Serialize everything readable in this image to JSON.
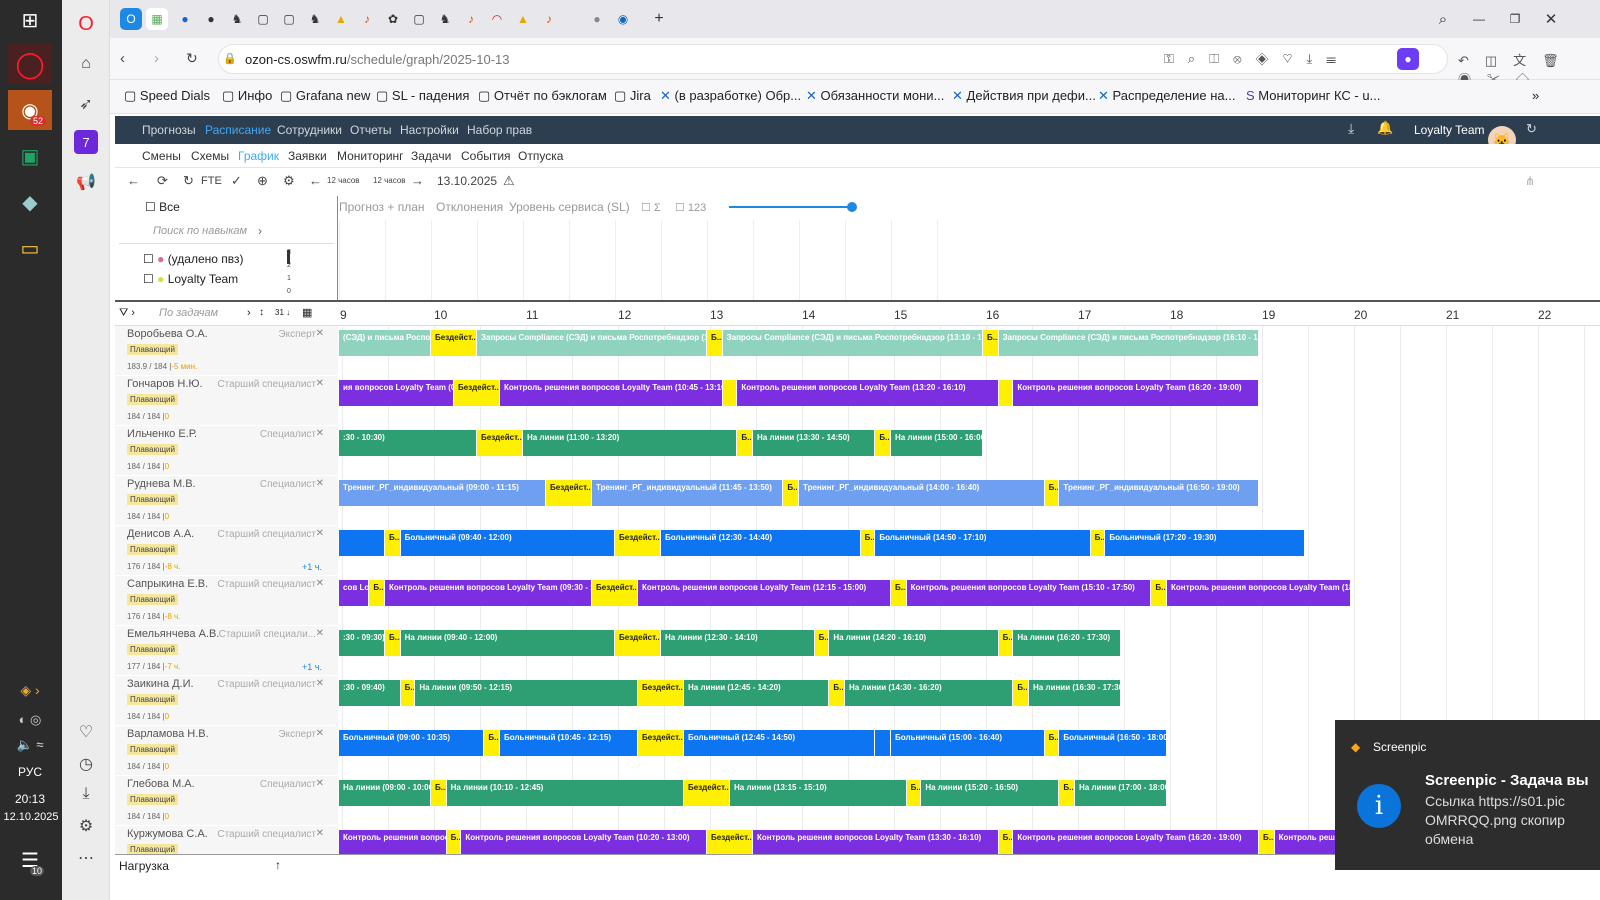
{
  "system": {
    "language": "РУС",
    "time": "20:13",
    "date": "12.10.2025",
    "notif_count": "10",
    "badge": "52"
  },
  "browser": {
    "url_host": "ozon-cs.oswfm.ru",
    "url_path": "/schedule/graph/2025-10-13",
    "bookmarks": [
      "Speed Dials",
      "Инфо",
      "Grafana new",
      "SL - падения",
      "Отчёт по бэклогам",
      "Jira",
      "(в разработке) Обр...",
      "Обязанности мони...",
      "Действия при дефи...",
      "Распределение на...",
      "Мониторинг КС - u..."
    ]
  },
  "app": {
    "nav_main": [
      "Прогнозы",
      "Расписание",
      "Сотрудники",
      "Отчеты",
      "Настройки",
      "Набор прав"
    ],
    "nav_main_active": "Расписание",
    "team": "Loyalty Team",
    "nav_sub": [
      "Смены",
      "Схемы",
      "График",
      "Заявки",
      "Мониторинг",
      "Задачи",
      "События",
      "Отпуска"
    ],
    "nav_sub_active": "График",
    "toolbar": {
      "fte": "FTE",
      "hours_a": "12 часов",
      "hours_b": "12 часов",
      "date": "13.10.2025"
    },
    "filters": {
      "all": "Все",
      "skill_search": "Поиск по навыкам",
      "task_search": "По задачам",
      "groups": [
        "(удалено пвз)",
        "Loyalty Team"
      ]
    },
    "chart_tabs": [
      "Прогноз + план",
      "Отклонения",
      "Уровень сервиса (SL)"
    ],
    "chart_checks": [
      "Σ",
      "123"
    ],
    "mini_axis": [
      "3",
      "2",
      "1",
      "0"
    ],
    "hours": [
      "9",
      "10",
      "11",
      "12",
      "13",
      "14",
      "15",
      "16",
      "17",
      "18",
      "19",
      "20",
      "21",
      "22"
    ],
    "footer": "Нагрузка"
  },
  "employees": [
    {
      "name": "Воробьева О.А.",
      "role": "Эксперт",
      "tag": "Плавающий",
      "hours": "183.9 / 184 |",
      "hours_extra": "-5 мин.",
      "ext": "",
      "segments": [
        {
          "s": 9.0,
          "e": 10.0,
          "c": "teal",
          "t": "(СЭД) и письма Роспот..."
        },
        {
          "s": 10.0,
          "e": 10.5,
          "c": "yellow",
          "t": "Бездейст..."
        },
        {
          "s": 10.5,
          "e": 13.0,
          "c": "teal",
          "t": "Запросы Compliance (СЭД) и письма Роспотребнадзор (10:30 -..."
        },
        {
          "s": 13.0,
          "e": 13.17,
          "c": "yellow",
          "t": "Б..."
        },
        {
          "s": 13.17,
          "e": 16.0,
          "c": "teal",
          "t": "Запросы Compliance (СЭД) и письма Роспотребнадзор (13:10 - 16:00)"
        },
        {
          "s": 16.0,
          "e": 16.17,
          "c": "yellow",
          "t": "Б..."
        },
        {
          "s": 16.17,
          "e": 19.0,
          "c": "teal",
          "t": "Запросы Compliance (СЭД) и письма Роспотребнадзор (16:10 - 19:00)"
        }
      ]
    },
    {
      "name": "Гончаров Н.Ю.",
      "role": "Старший специалист",
      "tag": "Плавающий",
      "hours": "184 / 184 |",
      "hours_extra": "0",
      "ext": "",
      "segments": [
        {
          "s": 9.0,
          "e": 10.25,
          "c": "purple",
          "t": "ия вопросов Loyalty Team (08:2..."
        },
        {
          "s": 10.25,
          "e": 10.75,
          "c": "yellow",
          "t": "Бездейст..."
        },
        {
          "s": 10.75,
          "e": 13.17,
          "c": "purple",
          "t": "Контроль решения вопросов Loyalty Team (10:45 - 13:10)"
        },
        {
          "s": 13.17,
          "e": 13.33,
          "c": "yellow",
          "t": ""
        },
        {
          "s": 13.33,
          "e": 16.17,
          "c": "purple",
          "t": "Контроль решения вопросов Loyalty Team (13:20 - 16:10)"
        },
        {
          "s": 16.17,
          "e": 16.33,
          "c": "yellow",
          "t": ""
        },
        {
          "s": 16.33,
          "e": 19.0,
          "c": "purple",
          "t": "Контроль решения вопросов Loyalty Team (16:20 - 19:00)"
        }
      ]
    },
    {
      "name": "Ильченко Е.Р.",
      "role": "Специалист",
      "tag": "Плавающий",
      "hours": "184 / 184 |",
      "hours_extra": "0",
      "ext": "",
      "segments": [
        {
          "s": 9.0,
          "e": 10.5,
          "c": "green",
          "t": ":30 - 10:30)"
        },
        {
          "s": 10.5,
          "e": 11.0,
          "c": "yellow",
          "t": "Бездейст..."
        },
        {
          "s": 11.0,
          "e": 13.33,
          "c": "green",
          "t": "На линии (11:00 - 13:20)"
        },
        {
          "s": 13.33,
          "e": 13.5,
          "c": "yellow",
          "t": "Б..."
        },
        {
          "s": 13.5,
          "e": 14.83,
          "c": "green",
          "t": "На линии (13:30 - 14:50)"
        },
        {
          "s": 14.83,
          "e": 15.0,
          "c": "yellow",
          "t": "Б..."
        },
        {
          "s": 15.0,
          "e": 16.0,
          "c": "green",
          "t": "На линии (15:00 - 16:00)"
        }
      ]
    },
    {
      "name": "Руднева М.В.",
      "role": "Специалист",
      "tag": "Плавающий",
      "hours": "184 / 184 |",
      "hours_extra": "0",
      "ext": "",
      "segments": [
        {
          "s": 9.0,
          "e": 11.25,
          "c": "lightblue",
          "t": "Тренинг_РГ_индивидуальный (09:00 - 11:15)"
        },
        {
          "s": 11.25,
          "e": 11.75,
          "c": "yellow",
          "t": "Бездейст..."
        },
        {
          "s": 11.75,
          "e": 13.83,
          "c": "lightblue",
          "t": "Тренинг_РГ_индивидуальный (11:45 - 13:50)"
        },
        {
          "s": 13.83,
          "e": 14.0,
          "c": "yellow",
          "t": "Б..."
        },
        {
          "s": 14.0,
          "e": 16.67,
          "c": "lightblue",
          "t": "Тренинг_РГ_индивидуальный (14:00 - 16:40)"
        },
        {
          "s": 16.67,
          "e": 16.83,
          "c": "yellow",
          "t": "Б..."
        },
        {
          "s": 16.83,
          "e": 19.0,
          "c": "lightblue",
          "t": "Тренинг_РГ_индивидуальный (16:50 - 19:00)"
        }
      ]
    },
    {
      "name": "Денисов А.А.",
      "role": "Старший специалист",
      "tag": "Плавающий",
      "hours": "176 / 184 |",
      "hours_extra": "-8 ч.",
      "ext": "+1 ч.",
      "segments": [
        {
          "s": 9.0,
          "e": 9.5,
          "c": "blue",
          "t": ""
        },
        {
          "s": 9.5,
          "e": 9.67,
          "c": "yellow",
          "t": "Б..."
        },
        {
          "s": 9.67,
          "e": 12.0,
          "c": "blue",
          "t": "Больничный (09:40 - 12:00)"
        },
        {
          "s": 12.0,
          "e": 12.5,
          "c": "yellow",
          "t": "Бездейст..."
        },
        {
          "s": 12.5,
          "e": 14.67,
          "c": "blue",
          "t": "Больничный (12:30 - 14:40)"
        },
        {
          "s": 14.67,
          "e": 14.83,
          "c": "yellow",
          "t": "Б..."
        },
        {
          "s": 14.83,
          "e": 17.17,
          "c": "blue",
          "t": "Больничный (14:50 - 17:10)"
        },
        {
          "s": 17.17,
          "e": 17.33,
          "c": "yellow",
          "t": "Б..."
        },
        {
          "s": 17.33,
          "e": 19.5,
          "c": "blue",
          "t": "Больничный (17:20 - 19:30)"
        }
      ]
    },
    {
      "name": "Сапрыкина Е.В.",
      "role": "Старший специалист",
      "tag": "Плавающий",
      "hours": "176 / 184 |",
      "hours_extra": "-8 ч.",
      "ext": "",
      "segments": [
        {
          "s": 9.0,
          "e": 9.33,
          "c": "purple",
          "t": "сов Lo..."
        },
        {
          "s": 9.33,
          "e": 9.5,
          "c": "yellow",
          "t": "Б..."
        },
        {
          "s": 9.5,
          "e": 11.75,
          "c": "purple",
          "t": "Контроль решения вопросов Loyalty Team (09:30 - 11:45)"
        },
        {
          "s": 11.75,
          "e": 12.25,
          "c": "yellow",
          "t": "Бездейст..."
        },
        {
          "s": 12.25,
          "e": 15.0,
          "c": "purple",
          "t": "Контроль решения вопросов Loyalty Team (12:15 - 15:00)"
        },
        {
          "s": 15.0,
          "e": 15.17,
          "c": "yellow",
          "t": "Б..."
        },
        {
          "s": 15.17,
          "e": 17.83,
          "c": "purple",
          "t": "Контроль решения вопросов Loyalty Team (15:10 - 17:50)"
        },
        {
          "s": 17.83,
          "e": 18.0,
          "c": "yellow",
          "t": "Б..."
        },
        {
          "s": 18.0,
          "e": 20.0,
          "c": "purple",
          "t": "Контроль решения вопросов Loyalty Team (18:00 -..."
        }
      ]
    },
    {
      "name": "Емельянчева А.В.",
      "role": "Старший специали...",
      "tag": "Плавающий",
      "hours": "177 / 184 |",
      "hours_extra": "-7 ч.",
      "ext": "+1 ч.",
      "segments": [
        {
          "s": 9.0,
          "e": 9.5,
          "c": "green",
          "t": ":30 - 09:30)"
        },
        {
          "s": 9.5,
          "e": 9.67,
          "c": "yellow",
          "t": "Б..."
        },
        {
          "s": 9.67,
          "e": 12.0,
          "c": "green",
          "t": "На линии (09:40 - 12:00)"
        },
        {
          "s": 12.0,
          "e": 12.5,
          "c": "yellow",
          "t": "Бездейст..."
        },
        {
          "s": 12.5,
          "e": 14.17,
          "c": "green",
          "t": "На линии (12:30 - 14:10)"
        },
        {
          "s": 14.17,
          "e": 14.33,
          "c": "yellow",
          "t": "Б..."
        },
        {
          "s": 14.33,
          "e": 16.17,
          "c": "green",
          "t": "На линии (14:20 - 16:10)"
        },
        {
          "s": 16.17,
          "e": 16.33,
          "c": "yellow",
          "t": "Б..."
        },
        {
          "s": 16.33,
          "e": 17.5,
          "c": "green",
          "t": "На линии (16:20 - 17:30)"
        }
      ]
    },
    {
      "name": "Заикина Д.И.",
      "role": "Старший специалист",
      "tag": "Плавающий",
      "hours": "184 / 184 |",
      "hours_extra": "0",
      "ext": "",
      "segments": [
        {
          "s": 9.0,
          "e": 9.67,
          "c": "green",
          "t": ":30 - 09:40)"
        },
        {
          "s": 9.67,
          "e": 9.83,
          "c": "yellow",
          "t": "Б..."
        },
        {
          "s": 9.83,
          "e": 12.25,
          "c": "green",
          "t": "На линии (09:50 - 12:15)"
        },
        {
          "s": 12.25,
          "e": 12.75,
          "c": "yellow",
          "t": "Бездейст..."
        },
        {
          "s": 12.75,
          "e": 14.33,
          "c": "green",
          "t": "На линии (12:45 - 14:20)"
        },
        {
          "s": 14.33,
          "e": 14.5,
          "c": "yellow",
          "t": "Б..."
        },
        {
          "s": 14.5,
          "e": 16.33,
          "c": "green",
          "t": "На линии (14:30 - 16:20)"
        },
        {
          "s": 16.33,
          "e": 16.5,
          "c": "yellow",
          "t": "Б..."
        },
        {
          "s": 16.5,
          "e": 17.5,
          "c": "green",
          "t": "На линии (16:30 - 17:30)"
        }
      ]
    },
    {
      "name": "Варламова Н.В.",
      "role": "Эксперт",
      "tag": "Плавающий",
      "hours": "184 / 184 |",
      "hours_extra": "0",
      "ext": "",
      "segments": [
        {
          "s": 9.0,
          "e": 10.58,
          "c": "blue",
          "t": "Больничный (09:00 - 10:35)"
        },
        {
          "s": 10.58,
          "e": 10.75,
          "c": "yellow",
          "t": "Б..."
        },
        {
          "s": 10.75,
          "e": 12.25,
          "c": "blue",
          "t": "Больничный (10:45 - 12:15)"
        },
        {
          "s": 12.25,
          "e": 12.75,
          "c": "yellow",
          "t": "Бездейст..."
        },
        {
          "s": 12.75,
          "e": 14.83,
          "c": "blue",
          "t": "Больничный (12:45 - 14:50)"
        },
        {
          "s": 14.83,
          "e": 15.0,
          "c": "blue2",
          "t": ""
        },
        {
          "s": 15.0,
          "e": 16.67,
          "c": "blue",
          "t": "Больничный (15:00 - 16:40)"
        },
        {
          "s": 16.67,
          "e": 16.83,
          "c": "yellow",
          "t": "Б..."
        },
        {
          "s": 16.83,
          "e": 18.0,
          "c": "blue",
          "t": "Больничный (16:50 - 18:00)"
        }
      ]
    },
    {
      "name": "Глебова М.А.",
      "role": "Специалист",
      "tag": "Плавающий",
      "hours": "184 / 184 |",
      "hours_extra": "0",
      "ext": "",
      "segments": [
        {
          "s": 9.0,
          "e": 10.0,
          "c": "green",
          "t": "На линии (09:00 - 10:00)"
        },
        {
          "s": 10.0,
          "e": 10.17,
          "c": "yellow",
          "t": "Б..."
        },
        {
          "s": 10.17,
          "e": 12.75,
          "c": "green",
          "t": "На линии (10:10 - 12:45)"
        },
        {
          "s": 12.75,
          "e": 13.25,
          "c": "yellow",
          "t": "Бездейст..."
        },
        {
          "s": 13.25,
          "e": 15.17,
          "c": "green",
          "t": "На линии (13:15 - 15:10)"
        },
        {
          "s": 15.17,
          "e": 15.33,
          "c": "yellow",
          "t": "Б..."
        },
        {
          "s": 15.33,
          "e": 16.83,
          "c": "green",
          "t": "На линии (15:20 - 16:50)"
        },
        {
          "s": 16.83,
          "e": 17.0,
          "c": "yellow",
          "t": "Б..."
        },
        {
          "s": 17.0,
          "e": 18.0,
          "c": "green",
          "t": "На линии (17:00 - 18:00)"
        }
      ]
    },
    {
      "name": "Куржумова С.А.",
      "role": "Старший специалист",
      "tag": "Плавающий",
      "hours": "",
      "hours_extra": "",
      "ext": "",
      "segments": [
        {
          "s": 9.0,
          "e": 10.17,
          "c": "purple",
          "t": "Контроль решения вопросс..."
        },
        {
          "s": 10.17,
          "e": 10.33,
          "c": "yellow",
          "t": "Б..."
        },
        {
          "s": 10.33,
          "e": 13.0,
          "c": "purple",
          "t": "Контроль решения вопросов Loyalty Team (10:20 - 13:00)"
        },
        {
          "s": 13.0,
          "e": 13.5,
          "c": "yellow",
          "t": "Бездейст..."
        },
        {
          "s": 13.5,
          "e": 16.17,
          "c": "purple",
          "t": "Контроль решения вопросов Loyalty Team (13:30 - 16:10)"
        },
        {
          "s": 16.17,
          "e": 16.33,
          "c": "yellow",
          "t": "Б..."
        },
        {
          "s": 16.33,
          "e": 19.0,
          "c": "purple",
          "t": "Контроль решения вопросов Loyalty Team (16:20 - 19:00)"
        },
        {
          "s": 19.0,
          "e": 19.17,
          "c": "yellow",
          "t": "Б..."
        },
        {
          "s": 19.17,
          "e": 20.0,
          "c": "purple",
          "t": "Контроль решения вопросов"
        }
      ]
    }
  ],
  "colors": {
    "teal": "#8fd3bf",
    "purple": "#7b2fe0",
    "green": "#2e9e73",
    "lightblue": "#6f9ff0",
    "blue": "#0d74f2",
    "blue2": "#0d74f2",
    "yellow": "#ffef00",
    "nav": "#2c3e50",
    "accent": "#3fa9f5"
  },
  "toast": {
    "app": "Screenpic",
    "title": "Screenpic - Задача вы",
    "line1": "Ссылка https://s01.pic",
    "line2": "OMRRQQ.png скопир",
    "line3": "обмена"
  }
}
